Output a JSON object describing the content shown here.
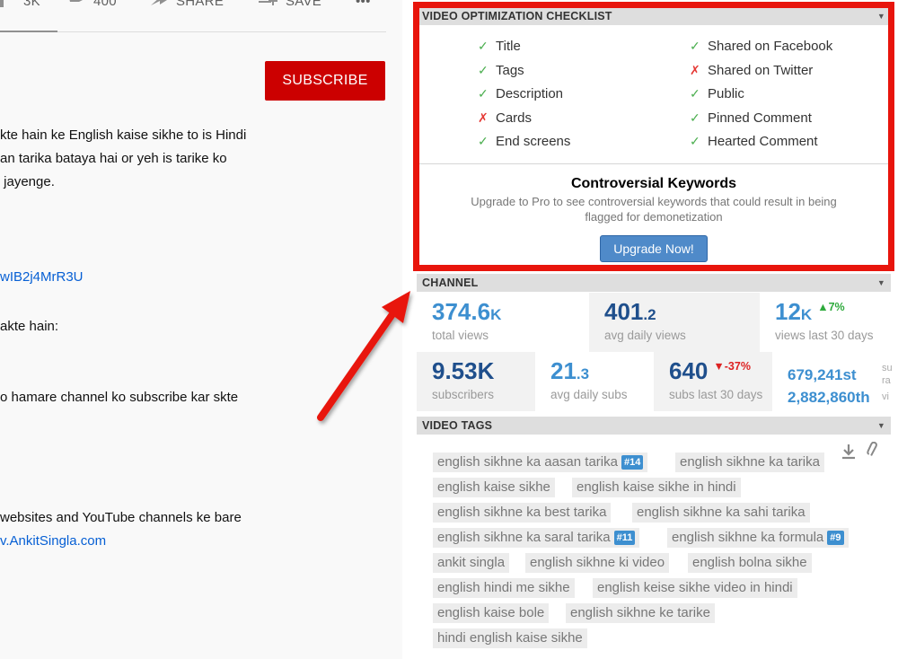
{
  "youtube": {
    "actions": {
      "like_count": "3K",
      "dislike_count": "400",
      "share_label": "SHARE",
      "save_label": "SAVE",
      "more_label": "•••"
    },
    "subscribe_label": "SUBSCRIBE",
    "description_lines": [
      "kte hain ke English kaise sikhe to is Hindi",
      "an tarika bataya hai or yeh is tarike ko",
      " jayenge.",
      "wIB2j4MrR3U",
      "akte hain:",
      "o hamare channel ko subscribe kar skte",
      "websites and YouTube channels ke bare",
      "v.AnkitSingla.com"
    ]
  },
  "checklist": {
    "header": "VIDEO OPTIMIZATION CHECKLIST",
    "left_items": [
      {
        "mark": "✓",
        "label": "Title"
      },
      {
        "mark": "✓",
        "label": "Tags"
      },
      {
        "mark": "✓",
        "label": "Description"
      },
      {
        "mark": "✗",
        "label": "Cards"
      },
      {
        "mark": "✓",
        "label": "End screens"
      }
    ],
    "right_items": [
      {
        "mark": "✓",
        "label": "Shared on Facebook"
      },
      {
        "mark": "✗",
        "label": "Shared on Twitter"
      },
      {
        "mark": "✓",
        "label": "Public"
      },
      {
        "mark": "✓",
        "label": "Pinned Comment"
      },
      {
        "mark": "✓",
        "label": "Hearted Comment"
      }
    ],
    "controversial_title": "Controversial Keywords",
    "controversial_text": "Upgrade to Pro to see controversial keywords that could result in being flagged for demonetization",
    "upgrade_label": "Upgrade Now!",
    "colors": {
      "pass": "#4caf50",
      "fail": "#e53935",
      "highlight": "#e8150c"
    }
  },
  "channel": {
    "header": "CHANNEL",
    "total_views": {
      "value": "374.6",
      "unit": "K",
      "label": "total views"
    },
    "avg_daily_views": {
      "value": "401",
      "decimal": ".2",
      "label": "avg daily views"
    },
    "views_30": {
      "value": "12",
      "unit": "K",
      "change": "▲7%",
      "label": "views last 30 days"
    },
    "subscribers": {
      "value": "9.53K",
      "label": "subscribers"
    },
    "avg_daily_subs": {
      "value": "21",
      "decimal": ".3",
      "label": "avg daily subs"
    },
    "subs_30": {
      "value": "640",
      "change": "▼-37%",
      "label": "subs last 30 days"
    },
    "ranks": [
      "679,241st",
      "2,882,860th"
    ],
    "rank_labels": [
      "su",
      "ra",
      "vi"
    ]
  },
  "tags": {
    "header": "VIDEO TAGS",
    "items": [
      {
        "text": "english sikhne ka aasan tarika",
        "rank": "#14"
      },
      {
        "text": "english sikhne ka tarika",
        "rank": ""
      },
      {
        "text": "english kaise sikhe",
        "rank": ""
      },
      {
        "text": "english kaise sikhe in hindi",
        "rank": ""
      },
      {
        "text": "english sikhne ka best tarika",
        "rank": ""
      },
      {
        "text": "english sikhne ka sahi tarika",
        "rank": ""
      },
      {
        "text": "english sikhne ka saral tarika",
        "rank": "#11"
      },
      {
        "text": "english sikhne ka formula",
        "rank": "#9"
      },
      {
        "text": "ankit singla",
        "rank": ""
      },
      {
        "text": "english sikhne ki video",
        "rank": ""
      },
      {
        "text": "english bolna sikhe",
        "rank": ""
      },
      {
        "text": "english hindi me sikhe",
        "rank": ""
      },
      {
        "text": "english keise sikhe video in hindi",
        "rank": ""
      },
      {
        "text": "english kaise bole",
        "rank": ""
      },
      {
        "text": "english sikhne ke tarike",
        "rank": ""
      },
      {
        "text": "hindi english kaise sikhe",
        "rank": ""
      }
    ]
  }
}
